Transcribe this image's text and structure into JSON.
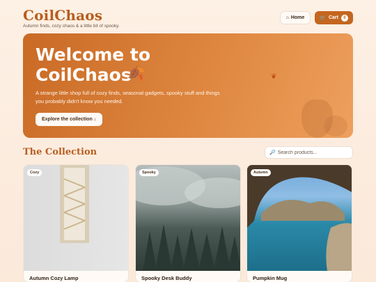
{
  "header": {
    "brand": "CoilChaos",
    "tagline": "Autumn finds, cozy chaos & a little bit of spooky.",
    "nav": {
      "home_label": "Home",
      "cart_label": "Cart",
      "cart_count": "0"
    }
  },
  "hero": {
    "title": "Welcome to CoilChaos",
    "description": "A strange little shop full of cozy finds, seasonal gadgets, spooky stuff and things you probably didn't know you needed.",
    "cta_label": "Explore the collection ↓"
  },
  "collection": {
    "title": "The Collection",
    "search_placeholder": "Search products...",
    "products": [
      {
        "tag": "Cozy",
        "name": "Autumn Cozy Lamp"
      },
      {
        "tag": "Spooky",
        "name": "Spooky Desk Buddy"
      },
      {
        "tag": "Autumn",
        "name": "Pumpkin Mug"
      }
    ]
  },
  "colors": {
    "accent": "#c4661f",
    "brand": "#b85e1e",
    "background": "#fdf0e4"
  }
}
